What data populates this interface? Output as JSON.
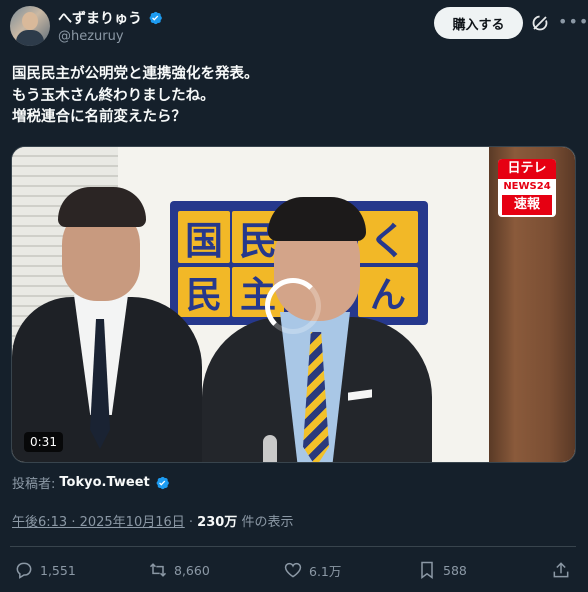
{
  "author": {
    "display_name": "へずまりゅう",
    "handle": "@hezuruy",
    "avatar_icon": "avatar-photo"
  },
  "header": {
    "buy_button": "購入する",
    "grok_icon": "grok-icon",
    "more_icon": "more-icon"
  },
  "tweet": {
    "lines": [
      "国民民主が公明党と連携強化を発表。",
      "もう玉木さん終わりましたね。",
      "増税連合に名前変えたら？"
    ]
  },
  "media": {
    "duration": "0:31",
    "banner_chars": [
      "国",
      "民",
      "く",
      "民",
      "主",
      "ん"
    ],
    "broadcaster": {
      "l1": "日テレ",
      "l2": "NEWS24",
      "l3": "速報"
    }
  },
  "poster": {
    "label": "投稿者:",
    "name": "Tokyo.Tweet"
  },
  "meta": {
    "timestamp": "午後6:13 · 2025年10月16日",
    "separator": " · ",
    "views": "230万",
    "views_suffix": " 件の表示"
  },
  "actions": {
    "replies": "1,551",
    "reposts": "8,660",
    "likes": "6.1万",
    "bookmarks": "588"
  },
  "colors": {
    "background": "#15202b",
    "text": "#f7f9f9",
    "muted": "#8b98a5",
    "verified": "#1d9bf0"
  }
}
